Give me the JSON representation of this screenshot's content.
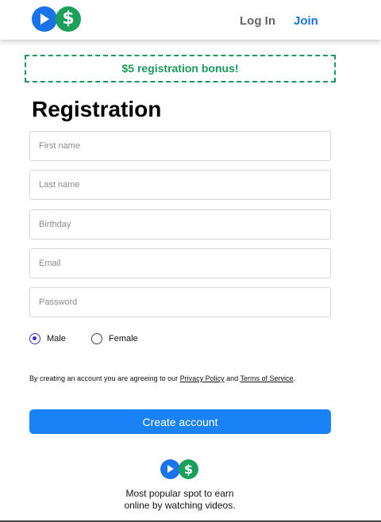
{
  "header": {
    "logo_play_icon": "play-icon",
    "logo_dollar_symbol": "$",
    "login_label": "Log In",
    "join_label": "Join"
  },
  "bonus_banner": "$5 registration bonus!",
  "form": {
    "title": "Registration",
    "first_name_placeholder": "First name",
    "last_name_placeholder": "Last name",
    "birthday_placeholder": "Birthday",
    "email_placeholder": "Email",
    "password_placeholder": "Password",
    "gender_options": [
      "Male",
      "Female"
    ],
    "gender_selected": "Male",
    "terms_prefix": "By creating an account you are agreeing to our ",
    "privacy_link": "Privacy Policy",
    "terms_and": " and ",
    "terms_link": "Terms of Service",
    "terms_suffix": ".",
    "submit_label": "Create account"
  },
  "footer": {
    "logo_dollar_symbol": "$",
    "tagline_line1": "Most popular spot to earn",
    "tagline_line2": "online by watching videos."
  },
  "colors": {
    "brand_blue": "#1a73e8",
    "brand_green": "#1aa05a",
    "button_blue": "#1a82f7",
    "radio_selected": "#3b2bd6"
  }
}
